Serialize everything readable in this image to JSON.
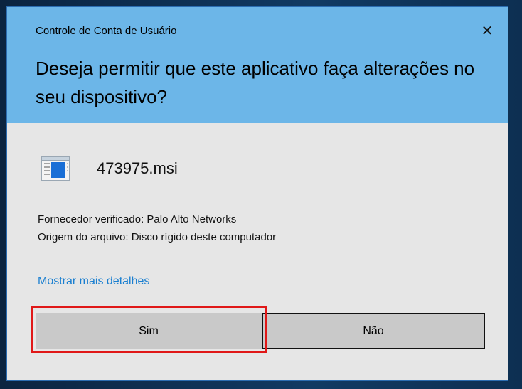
{
  "window": {
    "title": "Controle de Conta de Usuário",
    "close_glyph": "✕"
  },
  "header": {
    "headline": "Deseja permitir que este aplicativo faça alterações no seu dispositivo?"
  },
  "app": {
    "icon": "installer-window-icon",
    "name": "473975.msi"
  },
  "details": {
    "publisher": "Fornecedor verificado: Palo Alto Networks",
    "origin": "Origem do arquivo: Disco rígido deste computador"
  },
  "link": {
    "more_details": "Mostrar mais detalhes"
  },
  "buttons": {
    "yes_label": "Sim",
    "no_label": "Não"
  },
  "colors": {
    "header_bg": "#6cb6e8",
    "body_bg": "#e6e6e6",
    "link": "#1a7fd0",
    "annotation_highlight": "#e01818"
  }
}
